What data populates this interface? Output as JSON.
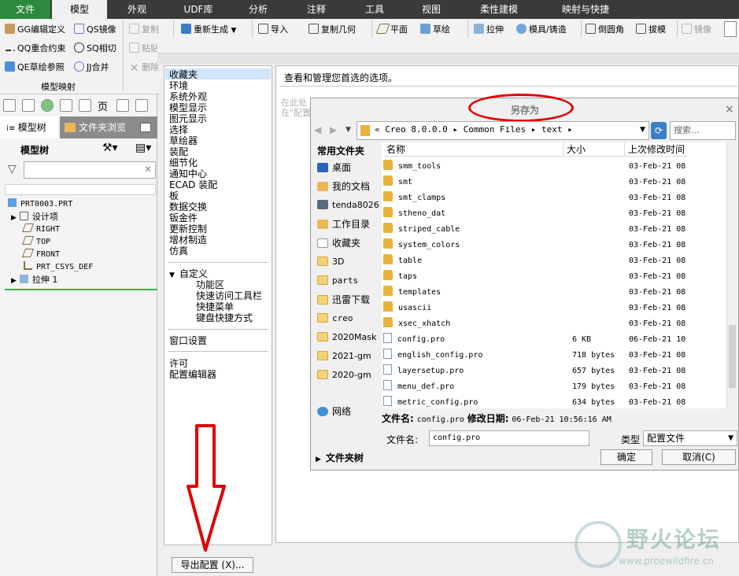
{
  "ribbon_tabs": [
    "文件",
    "模型",
    "外观",
    "UDF库",
    "分析",
    "注释",
    "工具",
    "视图",
    "柔性建模",
    "映射与快捷"
  ],
  "ribbon": {
    "left_tools": [
      "GG编辑定义",
      "QS镜像",
      "QQ重合约束",
      "SQ相切",
      "QE草绘参照",
      "JJ合并"
    ],
    "group_label": "模型映射",
    "copy": "复制",
    "regenerate": "重新生成",
    "import": "导入",
    "copy_geometry": "复制几何",
    "plane": "平面",
    "sketch": "草绘",
    "extrude": "拉伸",
    "mold": "模具/铸造",
    "round": "倒圆角",
    "draft": "拔模",
    "mirror": "镜像",
    "paste": "粘贴",
    "delete": "删除"
  },
  "left_panel": {
    "tabs": [
      "模型树",
      "文件夹浏览"
    ],
    "tree_label": "模型树",
    "tree": [
      "PRT0003.PRT",
      "设计项",
      "RIGHT",
      "TOP",
      "FRONT",
      "PRT_CSYS_DEF",
      "拉伸 1"
    ]
  },
  "options": {
    "categories": [
      "收藏夹",
      "环境",
      "系统外观",
      "模型显示",
      "图元显示",
      "选择",
      "草绘器",
      "装配",
      "细节化",
      "通知中心",
      "ECAD 装配",
      "板",
      "数据交换",
      "钣金件",
      "更新控制",
      "增材制造",
      "仿真"
    ],
    "customize": "自定义",
    "customize_items": [
      "功能区",
      "快速访问工具栏",
      "快捷菜单",
      "键盘快捷方式"
    ],
    "window_settings": "窗口设置",
    "license": "许可",
    "config_editor": "配置编辑器",
    "heading": "查看和管理您首选的选项。",
    "hidden_line1": "在此处",
    "hidden_line2": "在\"配置",
    "export_button": "导出配置 (X)..."
  },
  "save_as": {
    "title": "另存为",
    "path": [
      "Creo 8.0.0.0",
      "Common Files",
      "text"
    ],
    "search_placeholder": "搜索...",
    "common_folders_label": "常用文件夹",
    "sidebar": [
      "桌面",
      "我的文档",
      "tenda8026",
      "工作目录",
      "收藏夹",
      "3D",
      "parts",
      "迅雷下载",
      "creo",
      "2020Mask",
      "2021-gm",
      "2020-gm",
      "网络"
    ],
    "folder_tree": "文件夹树",
    "columns": [
      "名称",
      "大小",
      "上次修改时间"
    ],
    "files": [
      {
        "name": "smm_tools",
        "size": "",
        "date": "03-Feb-21 08",
        "folder": true
      },
      {
        "name": "smt",
        "size": "",
        "date": "03-Feb-21 08",
        "folder": true
      },
      {
        "name": "smt_clamps",
        "size": "",
        "date": "03-Feb-21 08",
        "folder": true
      },
      {
        "name": "stheno_dat",
        "size": "",
        "date": "03-Feb-21 08",
        "folder": true
      },
      {
        "name": "striped_cable",
        "size": "",
        "date": "03-Feb-21 08",
        "folder": true
      },
      {
        "name": "system_colors",
        "size": "",
        "date": "03-Feb-21 08",
        "folder": true
      },
      {
        "name": "table",
        "size": "",
        "date": "03-Feb-21 08",
        "folder": true
      },
      {
        "name": "taps",
        "size": "",
        "date": "03-Feb-21 08",
        "folder": true
      },
      {
        "name": "templates",
        "size": "",
        "date": "03-Feb-21 08",
        "folder": true
      },
      {
        "name": "usascii",
        "size": "",
        "date": "03-Feb-21 08",
        "folder": true
      },
      {
        "name": "xsec_xhatch",
        "size": "",
        "date": "03-Feb-21 08",
        "folder": true
      },
      {
        "name": "config.pro",
        "size": "6 KB",
        "date": "06-Feb-21 10",
        "folder": false
      },
      {
        "name": "english_config.pro",
        "size": "718 bytes",
        "date": "03-Feb-21 08",
        "folder": false
      },
      {
        "name": "layersetup.pro",
        "size": "657 bytes",
        "date": "03-Feb-21 08",
        "folder": false
      },
      {
        "name": "menu_def.pro",
        "size": "179 bytes",
        "date": "03-Feb-21 08",
        "folder": false
      },
      {
        "name": "metric_config.pro",
        "size": "634 bytes",
        "date": "03-Feb-21 08",
        "folder": false
      }
    ],
    "info_label": "文件名:",
    "info_name": "config.pro",
    "info_date_label": "修改日期:",
    "info_date": "06-Feb-21 10:56:16 AM",
    "filename_label": "文件名:",
    "filename_value": "config.pro",
    "type_label": "类型",
    "type_value": "配置文件",
    "ok": "确定",
    "cancel": "取消(C)"
  },
  "watermark": {
    "text": "野火论坛",
    "url": "www.proewildfire.cn"
  },
  "colors": {
    "accent": "#2b8a3e",
    "highlight_red": "#e00000",
    "selection": "#cfe5fb"
  }
}
